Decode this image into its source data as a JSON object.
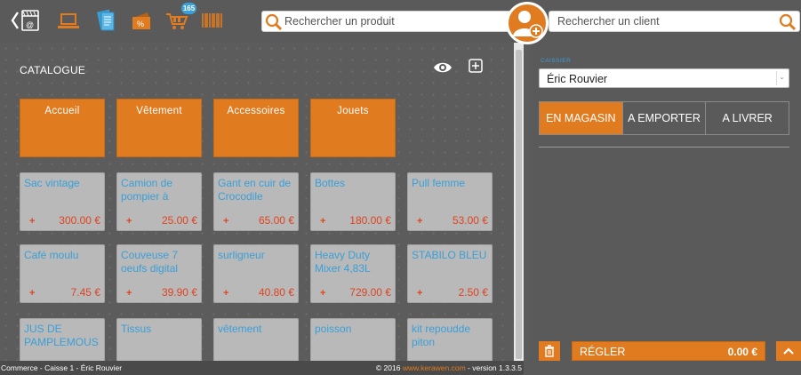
{
  "topbar": {
    "icons": [
      "back-store-icon",
      "laptop-icon",
      "catalog-book-icon",
      "discount-icon",
      "cart-icon",
      "barcode-icon"
    ],
    "cart_badge": "165",
    "product_search_placeholder": "Rechercher un produit",
    "client_search_placeholder": "Rechercher un client"
  },
  "catalogue": {
    "title": "CATALOGUE",
    "categories": [
      "Accueil",
      "Vêtement",
      "Accessoires",
      "Jouets"
    ],
    "products": [
      {
        "name": "Sac vintage",
        "price": "300.00 €"
      },
      {
        "name": "Camion de pompier à",
        "price": "25.00 €"
      },
      {
        "name": "Gant en cuir de Crocodile",
        "price": "65.00 €"
      },
      {
        "name": "Bottes",
        "price": "180.00 €"
      },
      {
        "name": "Pull femme",
        "price": "53.00 €"
      },
      {
        "name": "Café moulu",
        "price": "7.45 €"
      },
      {
        "name": "Couveuse 7 oeufs digital",
        "price": "39.90 €"
      },
      {
        "name": "surligneur",
        "price": "40.80 €"
      },
      {
        "name": "Heavy Duty Mixer 4,83L",
        "price": "729.00 €"
      },
      {
        "name": "STABILO BLEU",
        "price": "2.50 €"
      },
      {
        "name": "JUS DE PAMPLEMOUS",
        "price": ""
      },
      {
        "name": "Tissus",
        "price": ""
      },
      {
        "name": "vêtement",
        "price": ""
      },
      {
        "name": "poisson",
        "price": ""
      },
      {
        "name": "kit repoudde piton",
        "price": ""
      }
    ],
    "plus": "+"
  },
  "cart": {
    "cashier_label": "CAISSIER",
    "cashier": "Éric Rouvier",
    "modes": [
      "EN MAGASIN",
      "A EMPORTER",
      "A LIVRER"
    ],
    "active_mode": "EN MAGASIN",
    "pay_label": "RÉGLER",
    "pay_amount": "0.00 €"
  },
  "footer": {
    "left": "Commerce - Caisse 1 - Éric Rouvier",
    "right_prefix": "© 2016 ",
    "right_link": "www.kerawen.com",
    "right_suffix": " - version 1.3.3.5"
  },
  "colors": {
    "accent": "#e07b1f",
    "link_blue": "#3a9fd8",
    "price_red": "#e0431f",
    "tile_gray": "#b9b9b9"
  }
}
